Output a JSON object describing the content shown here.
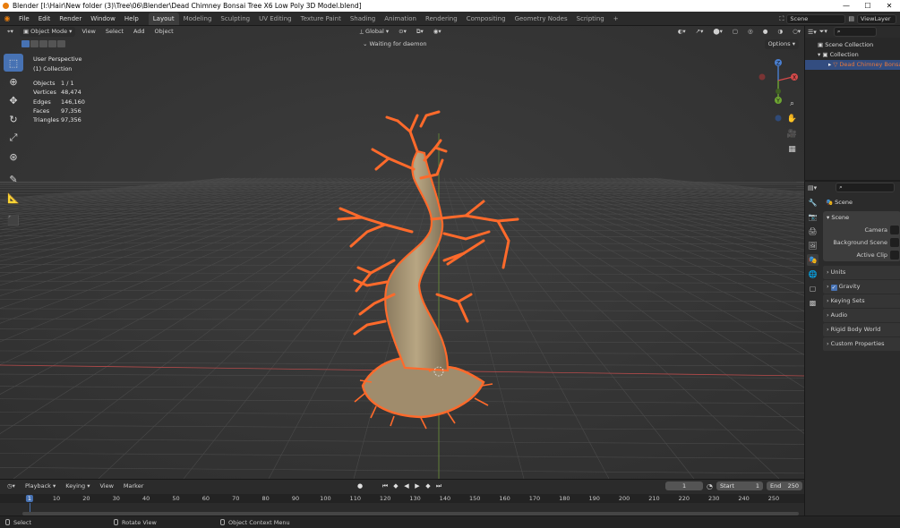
{
  "window": {
    "title": "Blender [I:\\Hair\\New folder (3)\\Tree\\06\\Blender\\Dead Chimney Bonsai Tree X6 Low Poly 3D Model.blend]",
    "min_label": "—",
    "max_label": "☐",
    "close_label": "✕"
  },
  "menu": [
    "File",
    "Edit",
    "Render",
    "Window",
    "Help"
  ],
  "workspaces": [
    {
      "label": "Layout",
      "active": true
    },
    {
      "label": "Modeling"
    },
    {
      "label": "Sculpting"
    },
    {
      "label": "UV Editing"
    },
    {
      "label": "Texture Paint"
    },
    {
      "label": "Shading"
    },
    {
      "label": "Animation"
    },
    {
      "label": "Rendering"
    },
    {
      "label": "Compositing"
    },
    {
      "label": "Geometry Nodes"
    },
    {
      "label": "Scripting"
    }
  ],
  "add_workspace": "+",
  "scene_field": "Scene",
  "view_layer_field": "ViewLayer",
  "viewport": {
    "mode": "Object Mode",
    "menus": [
      "View",
      "Select",
      "Add",
      "Object"
    ],
    "orientation": "Global",
    "daemon_status": "Waiting for daemon",
    "options_label": "Options",
    "view_name": "User Perspective",
    "collection_name": "(1) Collection",
    "stats": [
      {
        "k": "Objects",
        "v": "1 / 1"
      },
      {
        "k": "Vertices",
        "v": "48,474"
      },
      {
        "k": "Edges",
        "v": "146,160"
      },
      {
        "k": "Faces",
        "v": "97,356"
      },
      {
        "k": "Triangles",
        "v": "97,356"
      }
    ],
    "gizmo": {
      "x_label": "X",
      "y_label": "Y",
      "z_label": "Z"
    }
  },
  "outliner": {
    "rows": [
      {
        "label": "Scene Collection"
      },
      {
        "label": "Collection"
      },
      {
        "label": "Dead Chimney Bonsai Tree"
      }
    ]
  },
  "properties": {
    "header": "Scene",
    "panel_title": "Scene",
    "fields": [
      {
        "label": "Camera"
      },
      {
        "label": "Background Scene"
      },
      {
        "label": "Active Clip"
      }
    ],
    "subpanels": [
      {
        "label": "Units"
      },
      {
        "label": "Gravity",
        "checked": true
      },
      {
        "label": "Keying Sets"
      },
      {
        "label": "Audio"
      },
      {
        "label": "Rigid Body World"
      },
      {
        "label": "Custom Properties"
      }
    ]
  },
  "timeline": {
    "menus": [
      "Playback",
      "Keying",
      "View",
      "Marker"
    ],
    "current_frame": "1",
    "start_label": "Start",
    "start_value": "1",
    "end_label": "End",
    "end_value": "250",
    "ticks": [
      "1",
      "10",
      "20",
      "30",
      "40",
      "50",
      "60",
      "70",
      "80",
      "90",
      "100",
      "110",
      "120",
      "130",
      "140",
      "150",
      "160",
      "170",
      "180",
      "190",
      "200",
      "210",
      "220",
      "230",
      "240",
      "250"
    ]
  },
  "statusbar": {
    "select": "Select",
    "rotate": "Rotate View",
    "context": "Object Context Menu"
  },
  "colors": {
    "accent": "#4772b3",
    "selection_outline": "#ff6a2b",
    "x_axis": "#c04545",
    "y_axis": "#6c9f2a"
  }
}
